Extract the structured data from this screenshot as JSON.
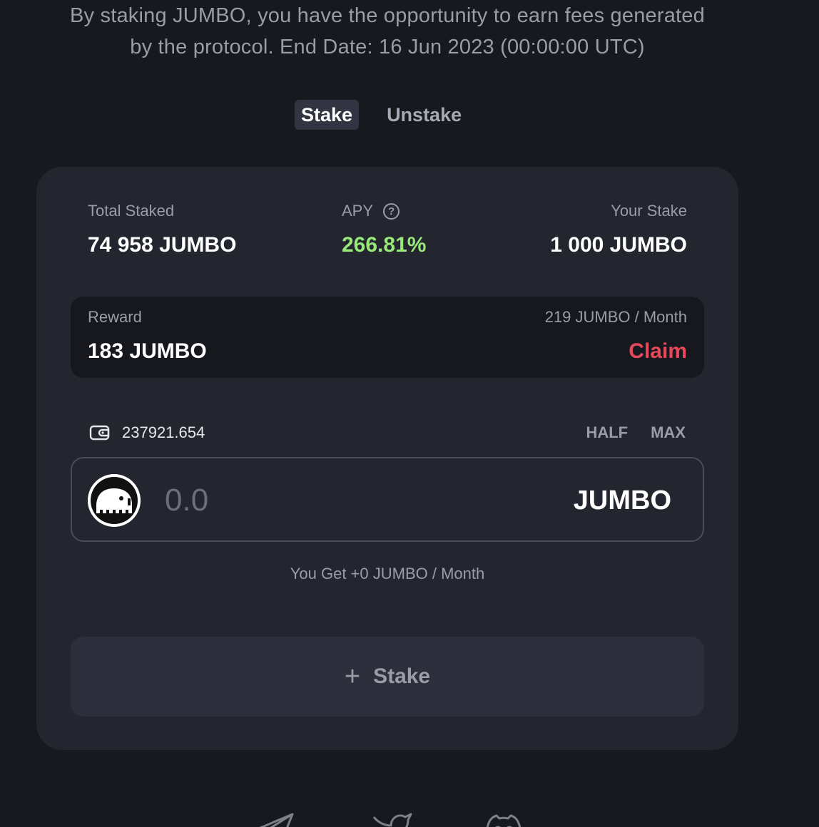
{
  "intro": {
    "line1": "By staking JUMBO, you have the opportunity to earn fees generated",
    "line2": "by the protocol. End Date: 16 Jun 2023 (00:00:00 UTC)"
  },
  "tabs": [
    {
      "label": "Stake",
      "active": true
    },
    {
      "label": "Unstake",
      "active": false
    }
  ],
  "stats": {
    "total_staked": {
      "label": "Total Staked",
      "value": "74 958 JUMBO"
    },
    "apy": {
      "label": "APY",
      "value": "266.81%",
      "color": "#98e87a"
    },
    "your_stake": {
      "label": "Your Stake",
      "value": "1 000 JUMBO"
    }
  },
  "reward": {
    "label": "Reward",
    "rate": "219 JUMBO / Month",
    "value": "183 JUMBO",
    "claim_label": "Claim",
    "claim_color": "#e9475a"
  },
  "balance": {
    "icon": "wallet-icon",
    "value": "237921.654",
    "half_label": "HALF",
    "max_label": "MAX"
  },
  "amount": {
    "placeholder": "0.0",
    "value": "",
    "token": "JUMBO",
    "token_icon": "jumbo-elephant-logo"
  },
  "estimate": "You Get +0 JUMBO / Month",
  "stake_button": {
    "icon": "plus-icon",
    "label": "Stake"
  },
  "socials": [
    {
      "icon": "telegram-icon"
    },
    {
      "icon": "twitter-icon"
    },
    {
      "icon": "discord-icon"
    }
  ]
}
